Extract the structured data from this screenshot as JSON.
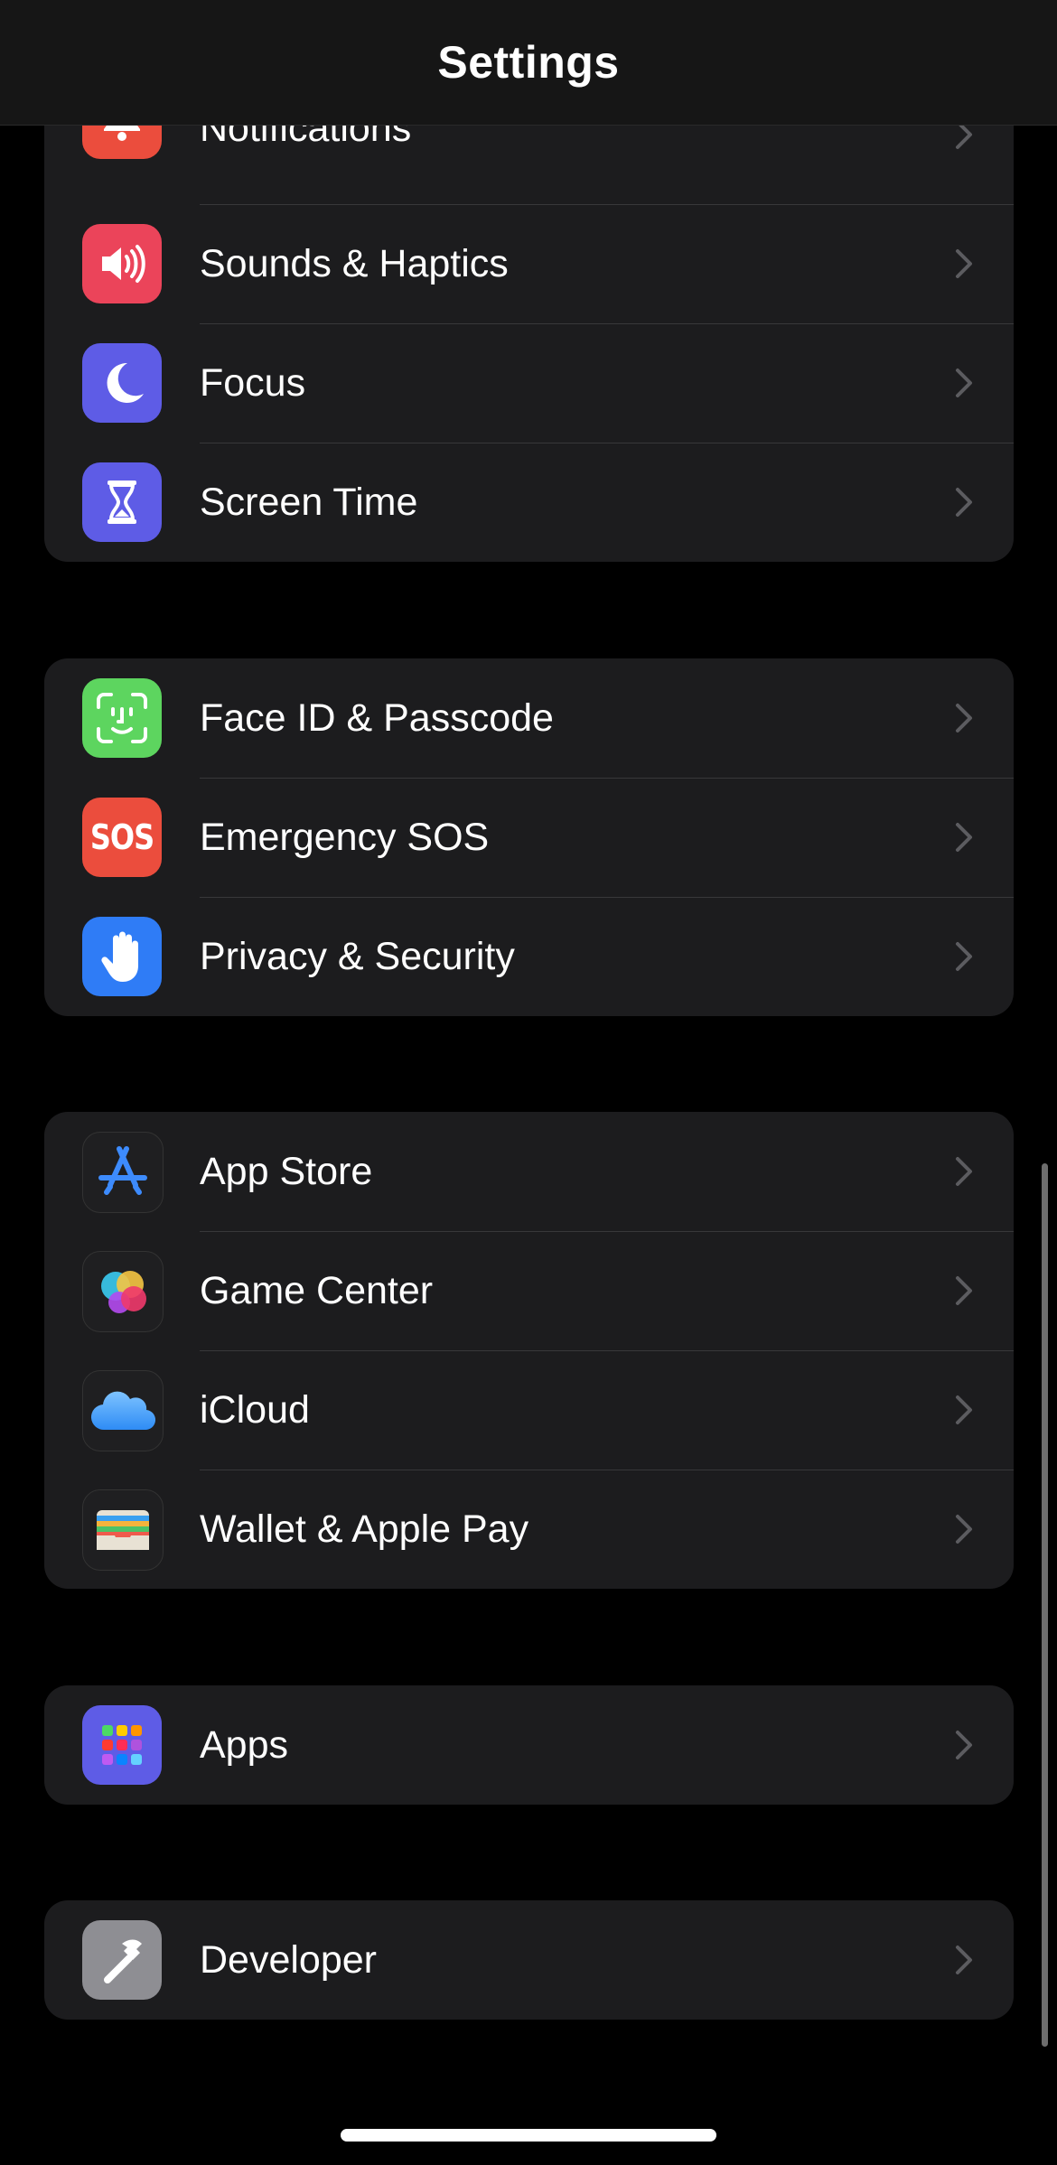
{
  "header": {
    "title": "Settings"
  },
  "groups": [
    {
      "items": [
        {
          "label": "Notifications",
          "icon": "bell-icon",
          "color": "#EB4D3D"
        },
        {
          "label": "Sounds & Haptics",
          "icon": "speaker-icon",
          "color": "#EB445A"
        },
        {
          "label": "Focus",
          "icon": "moon-icon",
          "color": "#5E5CE6"
        },
        {
          "label": "Screen Time",
          "icon": "hourglass-icon",
          "color": "#5E5CE6"
        }
      ]
    },
    {
      "items": [
        {
          "label": "Face ID & Passcode",
          "icon": "face-id-icon",
          "color": "#34C759"
        },
        {
          "label": "Emergency SOS",
          "icon": "sos-icon",
          "color": "#EB4D3D",
          "icon_text": "SOS"
        },
        {
          "label": "Privacy & Security",
          "icon": "hand-icon",
          "color": "#0A84FF"
        }
      ]
    },
    {
      "items": [
        {
          "label": "App Store",
          "icon": "app-store-icon",
          "color": "#1C1C1E"
        },
        {
          "label": "Game Center",
          "icon": "game-center-icon",
          "color": "#1C1C1E"
        },
        {
          "label": "iCloud",
          "icon": "cloud-icon",
          "color": "#1C1C1E"
        },
        {
          "label": "Wallet & Apple Pay",
          "icon": "wallet-icon",
          "color": "#1C1C1E"
        }
      ]
    },
    {
      "items": [
        {
          "label": "Apps",
          "icon": "apps-grid-icon",
          "color": "#5E5CE6"
        }
      ]
    },
    {
      "items": [
        {
          "label": "Developer",
          "icon": "hammer-icon",
          "color": "#8E8E93"
        }
      ]
    }
  ]
}
